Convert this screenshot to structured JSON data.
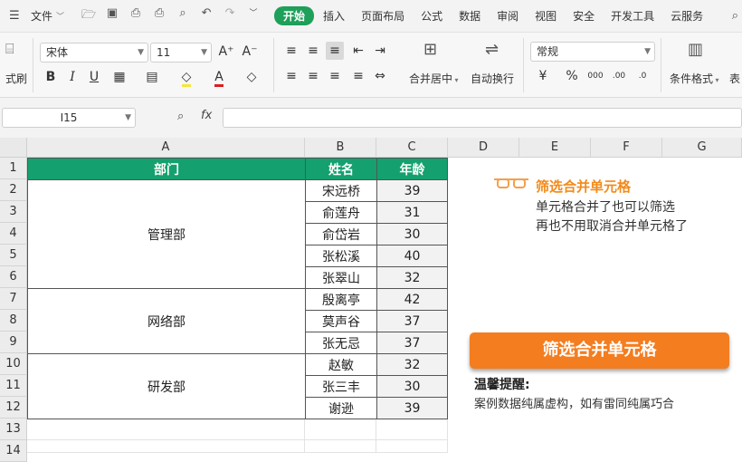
{
  "menubar": {
    "file_label": "文件",
    "tabs": [
      "开始",
      "插入",
      "页面布局",
      "公式",
      "数据",
      "审阅",
      "视图",
      "安全",
      "开发工具",
      "云服务"
    ],
    "active_tab": "开始",
    "accent_color": "#1e9f5a"
  },
  "ribbon": {
    "format_painter_label": "式刷",
    "font_name": "宋体",
    "font_size": "11",
    "merge_center_label": "合并居中",
    "wrap_text_label": "自动换行",
    "number_format": "常规",
    "conditional_format_label": "条件格式",
    "table_label": "表"
  },
  "formula_bar": {
    "cell_ref": "I15",
    "fx_label": "fx",
    "formula": ""
  },
  "grid": {
    "columns": [
      "A",
      "B",
      "C",
      "D",
      "E",
      "F",
      "G"
    ],
    "rows": [
      "1",
      "2",
      "3",
      "4",
      "5",
      "6",
      "7",
      "8",
      "9",
      "10",
      "11",
      "12",
      "13",
      "14"
    ]
  },
  "table": {
    "headers": [
      "部门",
      "姓名",
      "年龄"
    ],
    "header_color": "#14a06f",
    "groups": [
      {
        "dept": "管理部",
        "members": [
          {
            "name": "宋远桥",
            "age": "39"
          },
          {
            "name": "俞莲舟",
            "age": "31"
          },
          {
            "name": "俞岱岩",
            "age": "30"
          },
          {
            "name": "张松溪",
            "age": "40"
          },
          {
            "name": "张翠山",
            "age": "32"
          }
        ]
      },
      {
        "dept": "网络部",
        "members": [
          {
            "name": "殷离亭",
            "age": "42"
          },
          {
            "name": "莫声谷",
            "age": "37"
          },
          {
            "name": "张无忌",
            "age": "37"
          }
        ]
      },
      {
        "dept": "研发部",
        "members": [
          {
            "name": "赵敏",
            "age": "32"
          },
          {
            "name": "张三丰",
            "age": "30"
          },
          {
            "name": "谢逊",
            "age": "39"
          }
        ]
      }
    ]
  },
  "panel": {
    "title": "筛选合并单元格",
    "line1": "单元格合并了也可以筛选",
    "line2": "再也不用取消合并单元格了",
    "button_label": "筛选合并单元格",
    "tip_title": "温馨提醒:",
    "tip_text": "案例数据纯属虚构，如有雷同纯属巧合",
    "accent_color": "#f47d1f"
  }
}
